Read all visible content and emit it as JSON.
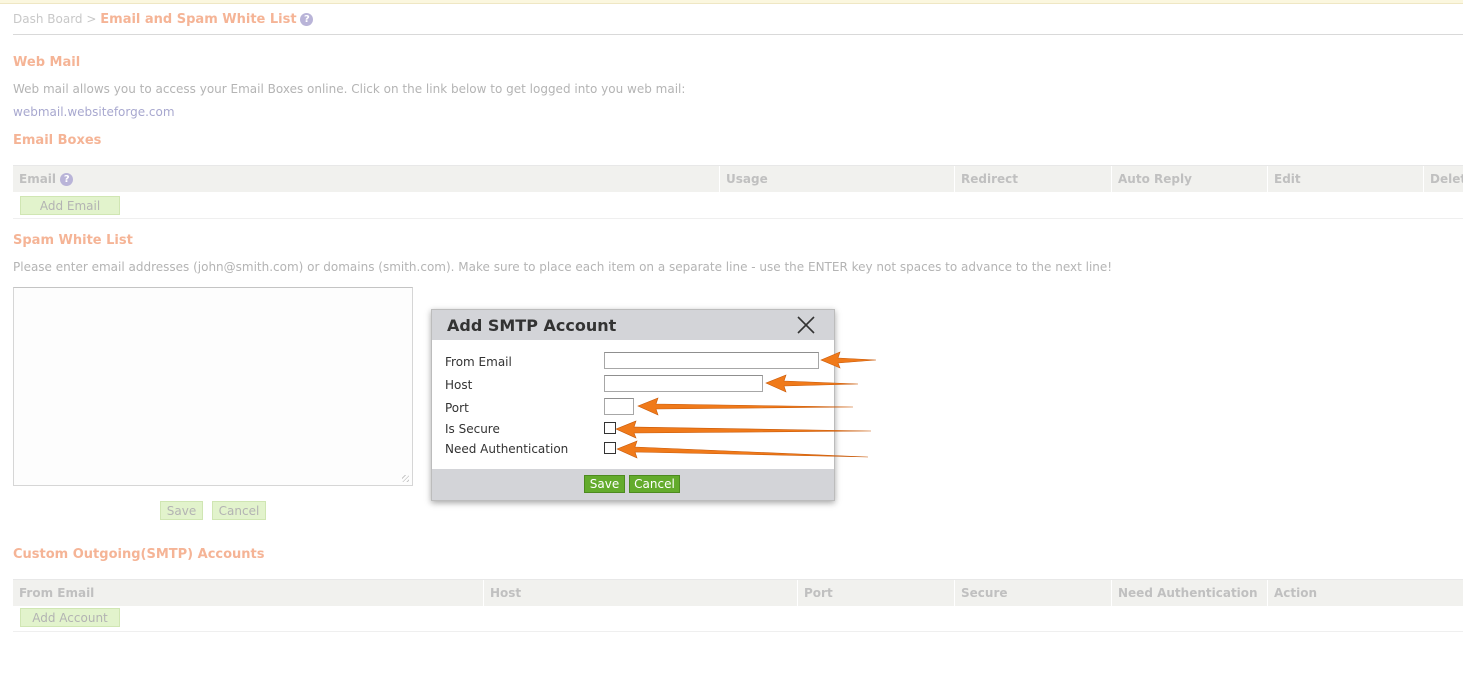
{
  "breadcrumb": {
    "home": "Dash Board",
    "separator": ">",
    "current": "Email and Spam White List",
    "help": "?"
  },
  "webmail": {
    "heading": "Web Mail",
    "description": "Web mail allows you to access your Email Boxes online. Click on the link below to get logged into you web mail:",
    "link": "webmail.websiteforge.com"
  },
  "email_boxes": {
    "heading": "Email Boxes",
    "columns": [
      "Email",
      "Usage",
      "Redirect",
      "Auto Reply",
      "Edit",
      "Delete"
    ],
    "add_label": "Add Email"
  },
  "spam": {
    "heading": "Spam White List",
    "description": "Please enter email addresses (john@smith.com) or domains (smith.com). Make sure to place each item on a separate line - use the ENTER key not spaces to advance to the next line!",
    "textarea_value": "",
    "save_label": "Save",
    "cancel_label": "Cancel"
  },
  "smtp": {
    "heading": "Custom Outgoing(SMTP) Accounts",
    "columns": [
      "From Email",
      "Host",
      "Port",
      "Secure",
      "Need Authentication",
      "Action"
    ],
    "add_label": "Add Account"
  },
  "dialog": {
    "title": "Add SMTP Account",
    "fields": {
      "from_email": {
        "label": "From Email",
        "value": ""
      },
      "host": {
        "label": "Host",
        "value": ""
      },
      "port": {
        "label": "Port",
        "value": ""
      },
      "is_secure": {
        "label": "Is Secure",
        "checked": false
      },
      "need_auth": {
        "label": "Need Authentication",
        "checked": false
      }
    },
    "save_label": "Save",
    "cancel_label": "Cancel"
  },
  "colors": {
    "heading": "#f5b496",
    "arrow": "#f07a1a",
    "button_green": "#63ab2c",
    "dialog_bar": "#d3d4d8"
  },
  "icons": {
    "help": "help-icon",
    "close": "close-icon",
    "arrow": "annotation-arrow"
  }
}
